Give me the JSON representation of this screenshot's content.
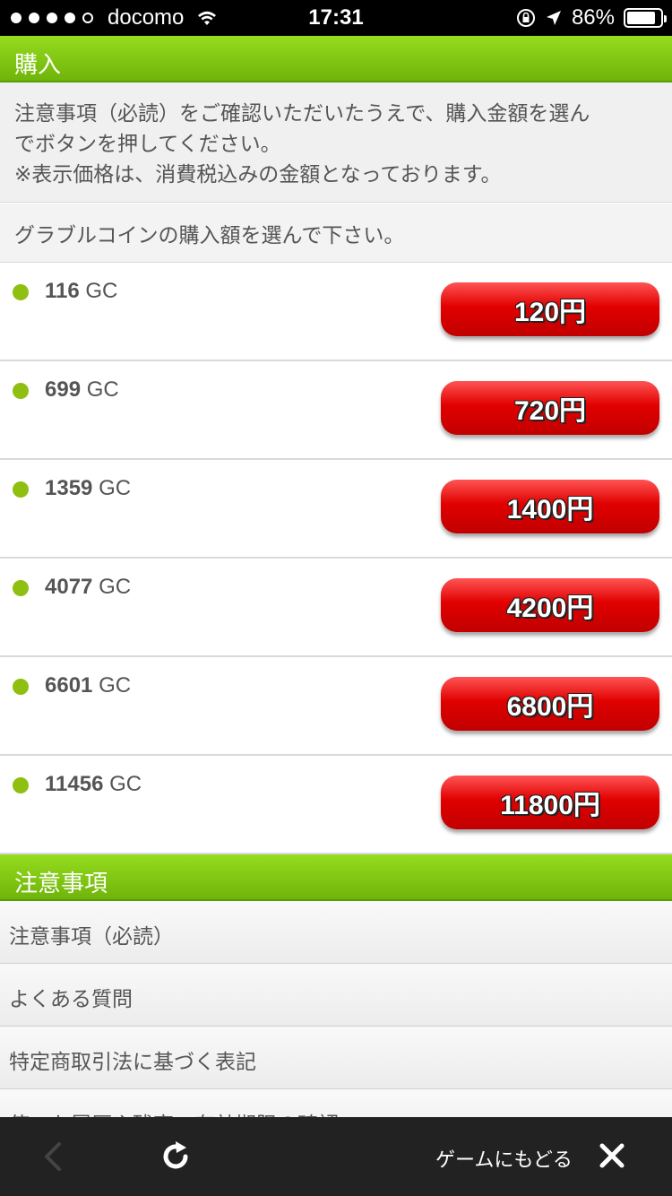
{
  "status_bar": {
    "carrier": "docomo",
    "time": "17:31",
    "battery": "86%",
    "battery_level": 0.86
  },
  "purchase_header": "購入",
  "notice": {
    "line1": "注意事項（必読）をご確認いただいたうえで、購入金額を選ん",
    "line2": "でボタンを押してください。",
    "line3": "※表示価格は、消費税込みの金額となっております。"
  },
  "choose_text": "グラブルコインの購入額を選んで下さい。",
  "purchase_options": [
    {
      "coins": "116",
      "unit": "GC",
      "price": "120円"
    },
    {
      "coins": "699",
      "unit": "GC",
      "price": "720円"
    },
    {
      "coins": "1359",
      "unit": "GC",
      "price": "1400円"
    },
    {
      "coins": "4077",
      "unit": "GC",
      "price": "4200円"
    },
    {
      "coins": "6601",
      "unit": "GC",
      "price": "6800円"
    },
    {
      "coins": "11456",
      "unit": "GC",
      "price": "11800円"
    }
  ],
  "notes_header": "注意事項",
  "menu_items": [
    "注意事項（必読）",
    "よくある質問",
    "特定商取引法に基づく表記",
    "使った履歴や残高、有効期限の確認"
  ],
  "bottom_bar": {
    "return_label": "ゲームにもどる"
  },
  "colors": {
    "accent_green": "#80c814",
    "button_red": "#e10000",
    "bullet_green": "#8fbf11"
  }
}
